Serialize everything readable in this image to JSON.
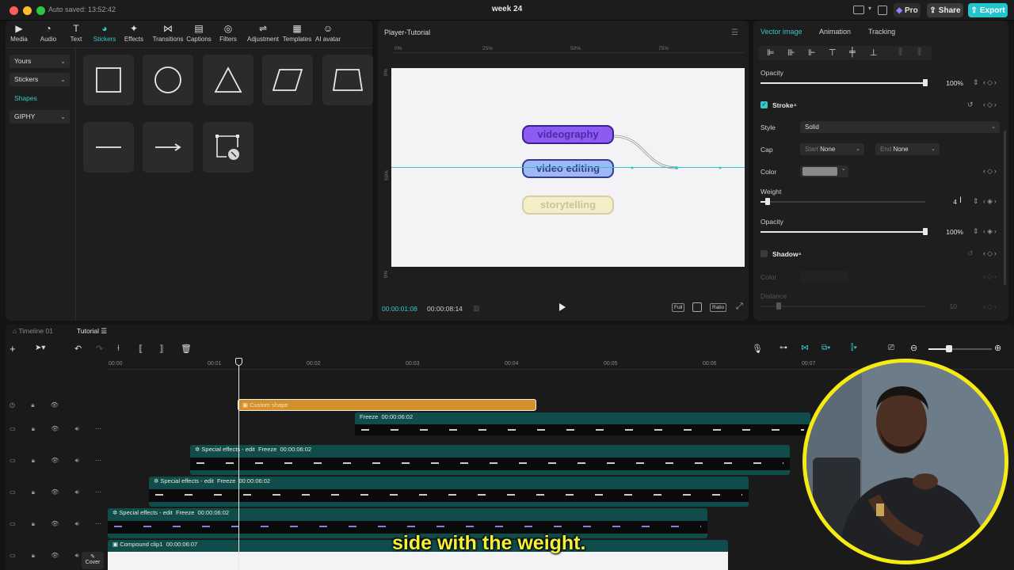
{
  "window": {
    "autosave": "Auto saved: 13:52:42",
    "title": "week 24"
  },
  "topbar": {
    "pro_label": "Pro",
    "share_label": "Share",
    "export_label": "Export"
  },
  "toolbar": [
    {
      "label": "Media",
      "icon": "media-icon"
    },
    {
      "label": "Audio",
      "icon": "audio-icon"
    },
    {
      "label": "Text",
      "icon": "text-icon"
    },
    {
      "label": "Stickers",
      "icon": "stickers-icon",
      "active": true
    },
    {
      "label": "Effects",
      "icon": "effects-icon"
    },
    {
      "label": "Transitions",
      "icon": "transitions-icon"
    },
    {
      "label": "Captions",
      "icon": "captions-icon"
    },
    {
      "label": "Filters",
      "icon": "filters-icon"
    },
    {
      "label": "Adjustment",
      "icon": "adjustment-icon"
    },
    {
      "label": "Templates",
      "icon": "templates-icon"
    },
    {
      "label": "AI avatar",
      "icon": "ai-avatar-icon"
    }
  ],
  "categories": [
    {
      "label": "Yours"
    },
    {
      "label": "Stickers"
    },
    {
      "label": "Shapes",
      "active": true
    },
    {
      "label": "GIPHY"
    }
  ],
  "player": {
    "title": "Player-Tutorial",
    "ruler_h": [
      "0%",
      "25%",
      "50%",
      "75%"
    ],
    "ruler_v": [
      "0%",
      "50%",
      "0%"
    ],
    "pills": [
      "videography",
      "video editing",
      "storytelling"
    ],
    "time_current": "00:00:01:08",
    "time_total": "00:00:08:14",
    "ctrl_full": "Full",
    "ctrl_ratio": "Ratio"
  },
  "inspector": {
    "tabs": [
      "Vector image",
      "Animation",
      "Tracking"
    ],
    "opacity_label": "Opacity",
    "opacity_value": "100%",
    "stroke_label": "Stroke",
    "style_label": "Style",
    "style_value": "Solid",
    "cap_label": "Cap",
    "start_label": "Start",
    "start_value": "None",
    "end_label": "End",
    "end_value": "None",
    "color_label": "Color",
    "stroke_color": "#8a8a8a",
    "weight_label": "Weight",
    "weight_value": "4",
    "opacity2_label": "Opacity",
    "opacity2_value": "100%",
    "shadow_label": "Shadow",
    "shadow_color_label": "Color",
    "distance_label": "Distance",
    "distance_value": "10"
  },
  "timeline": {
    "tabs": [
      "Timeline 01",
      "Tutorial"
    ],
    "ruler": [
      "00:00",
      "00:01",
      "00:02",
      "00:03",
      "00:04",
      "00:05",
      "00:06",
      "00:07"
    ],
    "tracks": [
      {
        "name": "Custom shape"
      },
      {
        "tag": "Freeze",
        "time": "00:00:06:02"
      },
      {
        "name": "Special effects - edit",
        "tag": "Freeze",
        "time": "00:00:06:02"
      },
      {
        "name": "Special effects - edit",
        "tag": "Freeze",
        "time": "00:00:06:02"
      },
      {
        "name": "Special effects - edit",
        "tag": "Freeze",
        "time": "00:00:06:02"
      },
      {
        "name": "Compound clip1",
        "time": "00:00:06:07"
      }
    ],
    "cover_label": "Cover"
  },
  "subtitle": "side with the weight.",
  "colors": {
    "accent": "#39c6c9",
    "purple": "#8c5cf2",
    "blue": "#9fb7f5",
    "cream": "#f4eec9",
    "clip_orange": "#d4902a",
    "export": "#23c5cc",
    "webcam_ring": "#f5ea12"
  }
}
